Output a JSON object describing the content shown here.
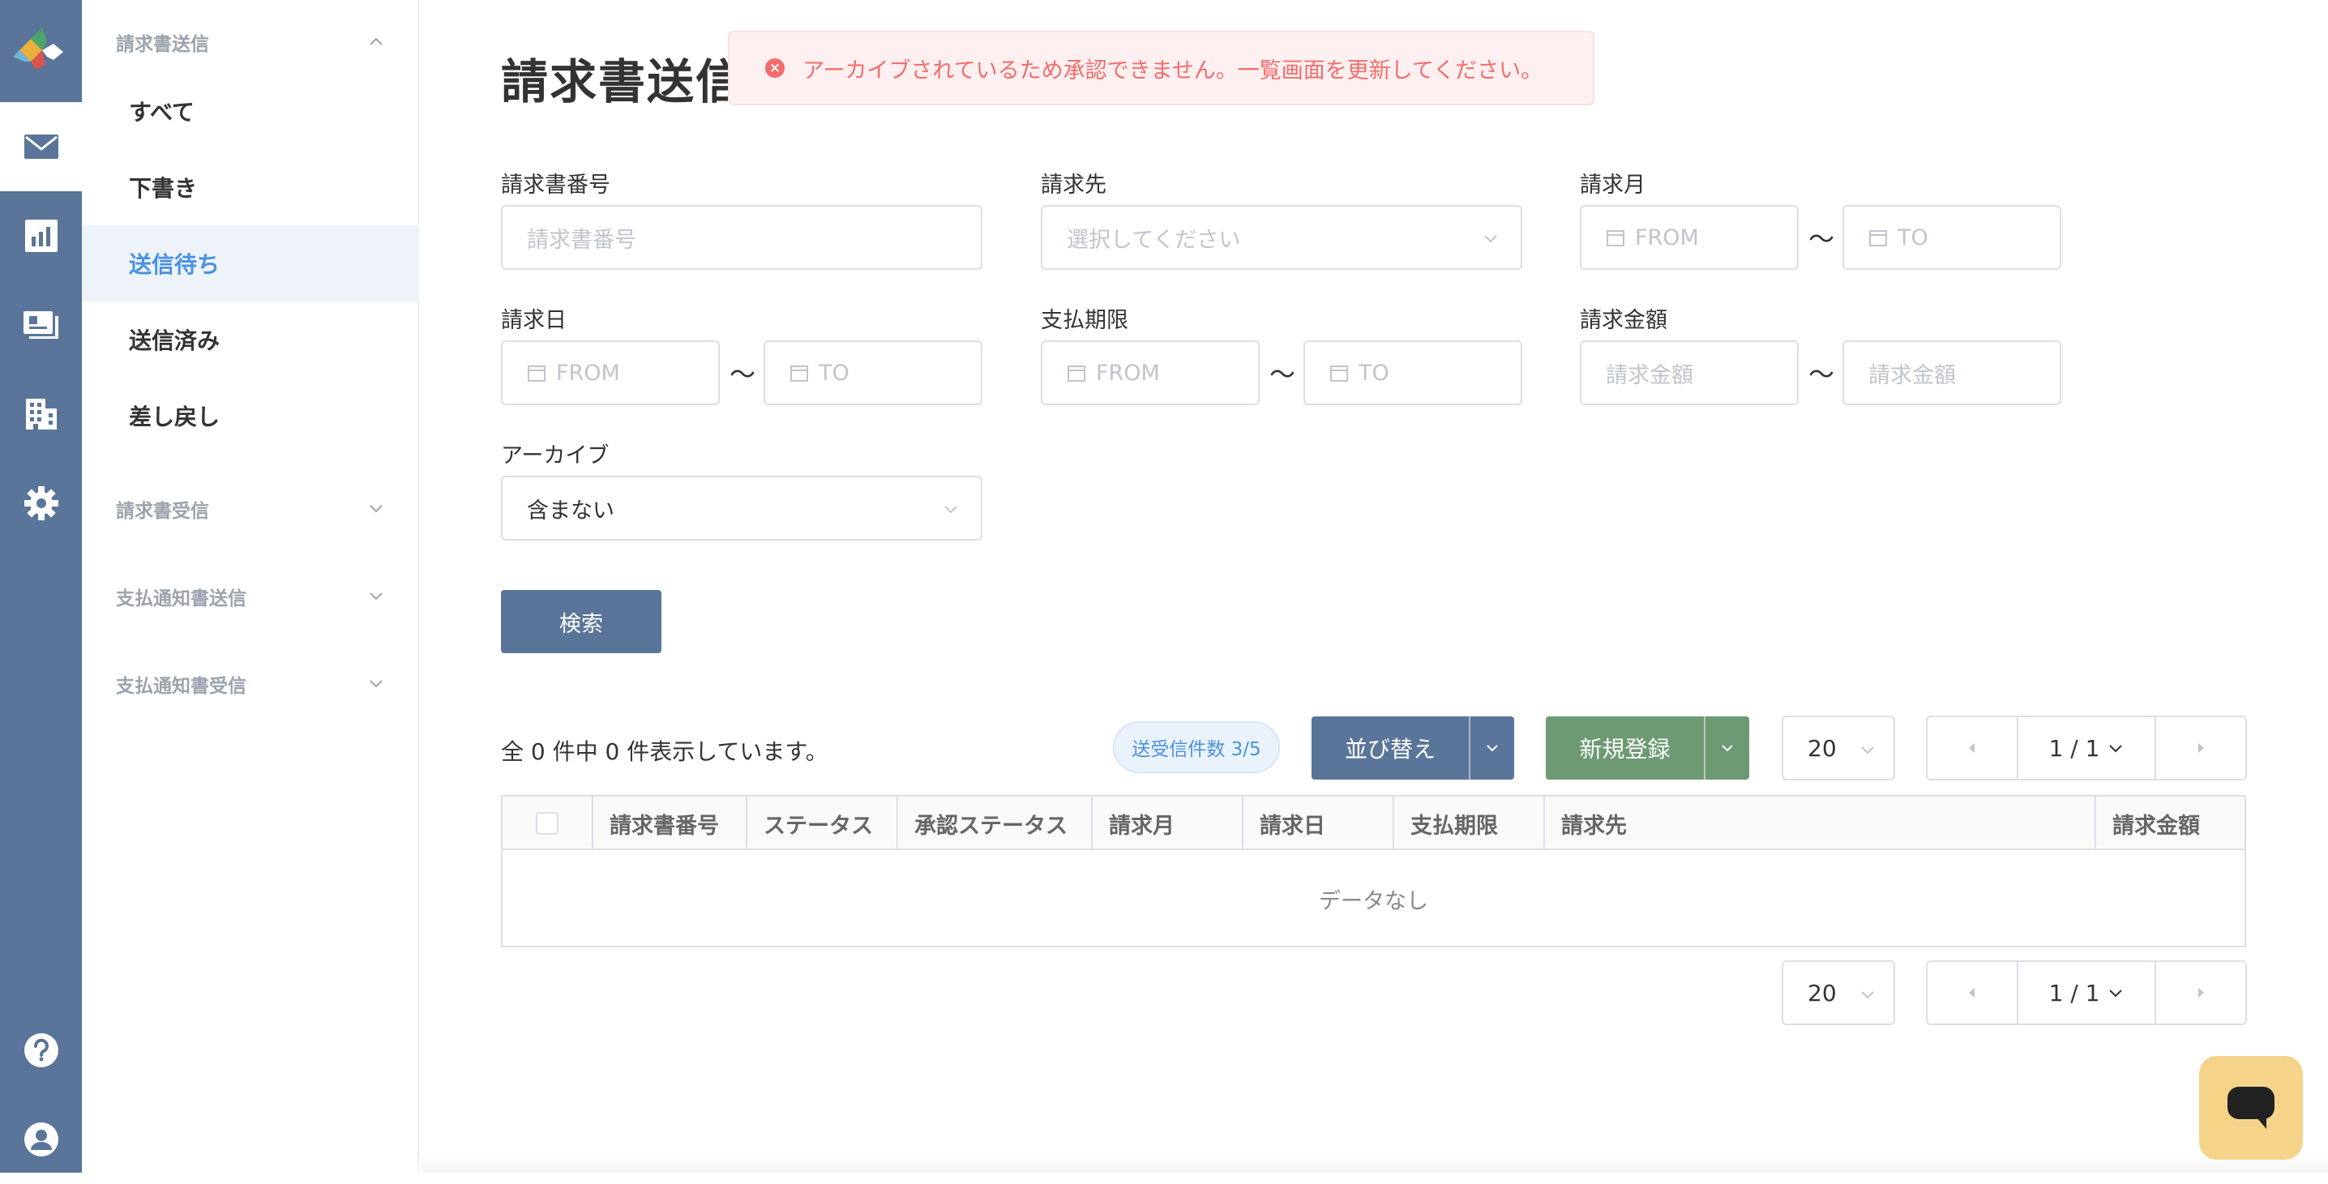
{
  "colors": {
    "rail": "#5a7599",
    "accent": "#4a90e2",
    "primary_button": "#5a7599",
    "register_button": "#6d9a73",
    "error": "#f56c6c",
    "chat": "#f5d48a"
  },
  "rail": {
    "icons": [
      "app-logo-icon",
      "mail-icon",
      "bar-chart-icon",
      "id-card-icon",
      "building-icon",
      "gear-icon",
      "help-icon",
      "user-icon"
    ]
  },
  "submenu": {
    "groups": [
      {
        "label": "請求書送信",
        "expanded": true,
        "items": [
          "すべて",
          "下書き",
          "送信待ち",
          "送信済み",
          "差し戻し"
        ],
        "active": "送信待ち"
      },
      {
        "label": "請求書受信",
        "expanded": false
      },
      {
        "label": "支払通知書送信",
        "expanded": false
      },
      {
        "label": "支払通知書受信",
        "expanded": false
      }
    ]
  },
  "page": {
    "title": "請求書送信"
  },
  "toast": {
    "message": "アーカイブされているため承認できません。一覧画面を更新してください。"
  },
  "filters": {
    "invoice_no": {
      "label": "請求書番号",
      "placeholder": "請求書番号"
    },
    "recipient": {
      "label": "請求先",
      "placeholder": "選択してください"
    },
    "billing_month": {
      "label": "請求月",
      "from": "FROM",
      "to": "TO"
    },
    "billing_date": {
      "label": "請求日",
      "from": "FROM",
      "to": "TO"
    },
    "due_date": {
      "label": "支払期限",
      "from": "FROM",
      "to": "TO"
    },
    "amount": {
      "label": "請求金額",
      "from": "請求金額",
      "to": "請求金額"
    },
    "archive": {
      "label": "アーカイブ",
      "value": "含まない"
    },
    "range_sep": "～",
    "search_label": "検索"
  },
  "list": {
    "count_text": "全 0 件中 0 件表示しています。",
    "quota": "送受信件数 3/5",
    "sort_label": "並び替え",
    "register_label": "新規登録",
    "page_size": "20",
    "page_indicator": "1 / 1",
    "columns": [
      "請求書番号",
      "ステータス",
      "承認ステータス",
      "請求月",
      "請求日",
      "支払期限",
      "請求先",
      "請求金額"
    ],
    "empty_text": "データなし"
  }
}
